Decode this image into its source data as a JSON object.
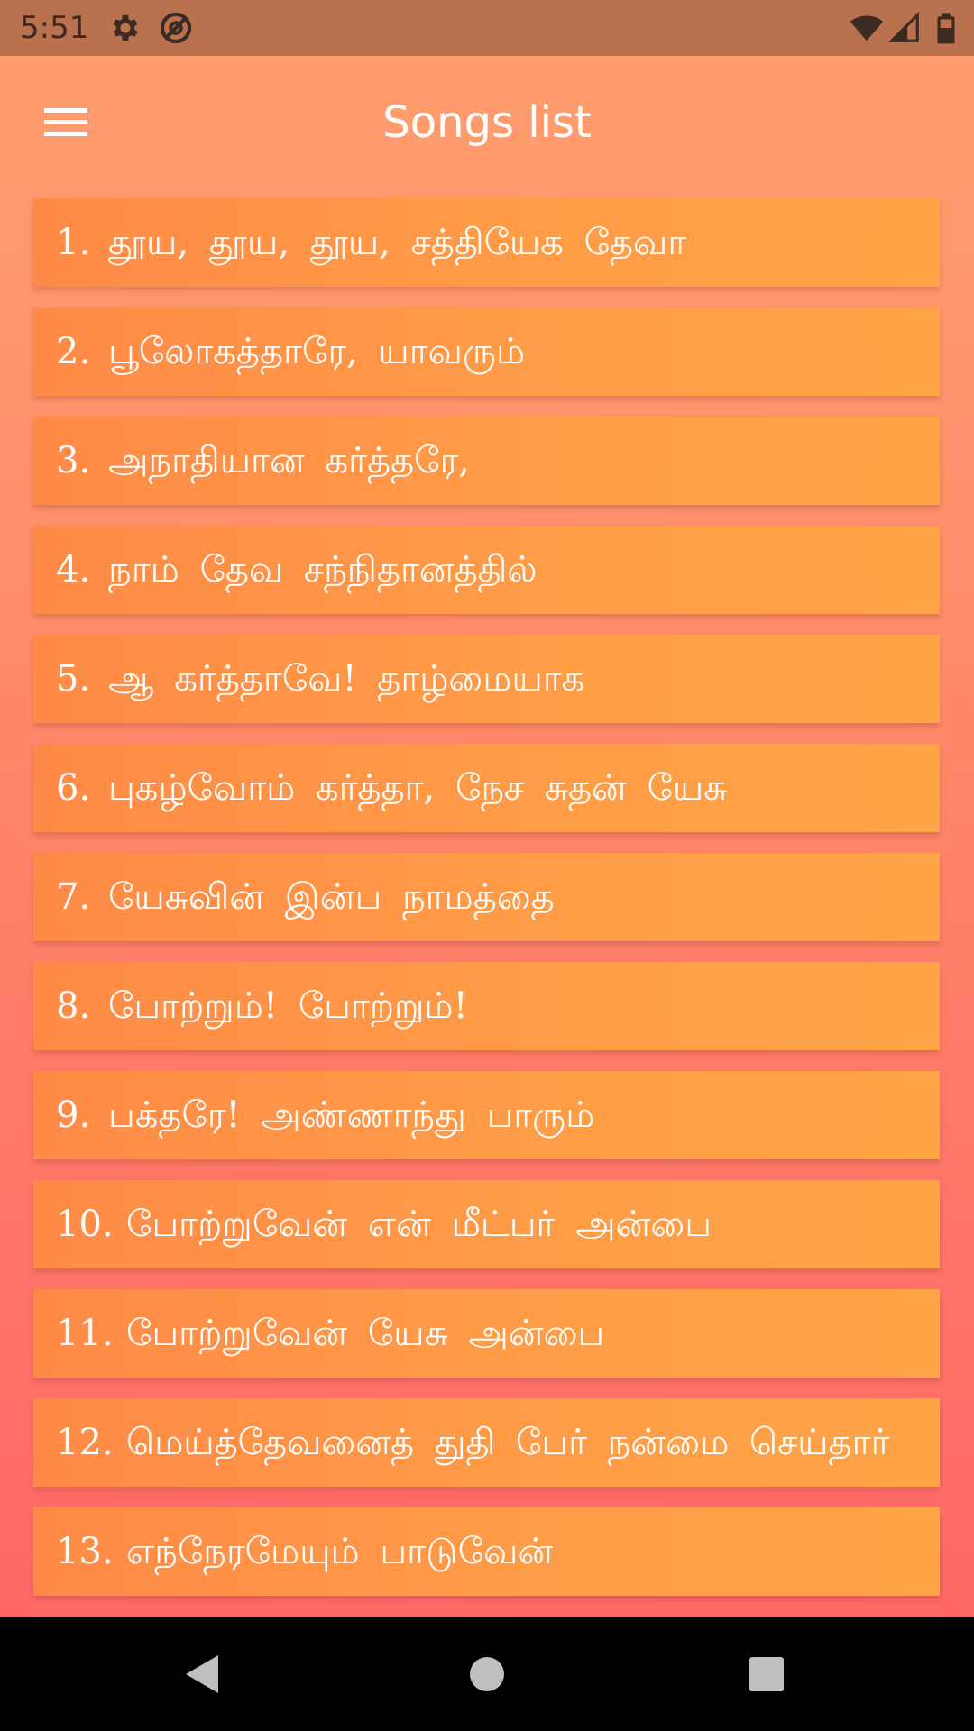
{
  "status_bar": {
    "time": "5:51",
    "icons": [
      "settings-gear-icon",
      "vpn-at-icon",
      "wifi-icon",
      "cellular-signal-icon",
      "battery-icon"
    ]
  },
  "app_bar": {
    "title": "Songs list",
    "menu_icon": "hamburger-menu-icon"
  },
  "songs": [
    {
      "number": "1.",
      "title": "தூய, தூய, தூய, சத்தியேக தேவா"
    },
    {
      "number": "2.",
      "title": "பூலோகத்தாரே, யாவரும்"
    },
    {
      "number": "3.",
      "title": "அநாதியான கர்த்தரே,"
    },
    {
      "number": "4.",
      "title": "நாம் தேவ சந்நிதானத்தில்"
    },
    {
      "number": "5.",
      "title": "ஆ கர்த்தாவே! தாழ்மையாக"
    },
    {
      "number": "6.",
      "title": "புகழ்வோம் கர்த்தா, நேச சுதன் யேசு"
    },
    {
      "number": "7.",
      "title": "யேசுவின் இன்ப நாமத்தை"
    },
    {
      "number": "8.",
      "title": "போற்றும்! போற்றும்!"
    },
    {
      "number": "9.",
      "title": "பக்தரே! அண்ணாந்து பாரும்"
    },
    {
      "number": "10.",
      "title": "போற்றுவேன் என் மீட்பர் அன்பை"
    },
    {
      "number": "11.",
      "title": "போற்றுவேன் யேசு அன்பை"
    },
    {
      "number": "12.",
      "title": "மெய்த்தேவனைத் துதி பேர் நன்மை செய்தார்"
    },
    {
      "number": "13.",
      "title": "எந்நேரமேயும் பாடுவேன்"
    }
  ],
  "nav_bar": {
    "back_icon": "back-triangle-icon",
    "home_icon": "home-circle-icon",
    "recents_icon": "recents-square-icon"
  },
  "colors": {
    "status_bar": "#b9714e",
    "background_top": "#ff9f6e",
    "background_bottom": "#ff6567",
    "item_left": "#ff8a47",
    "item_right": "#ffa447",
    "text": "#ffffff"
  }
}
